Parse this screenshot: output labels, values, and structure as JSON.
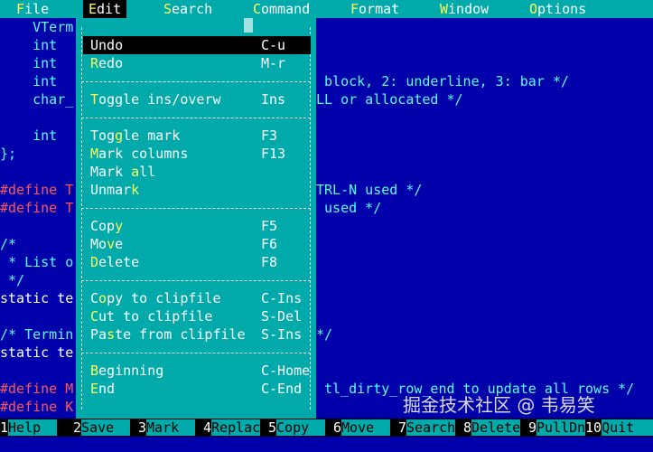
{
  "menubar": {
    "file": {
      "hk": "F",
      "rest": "ile"
    },
    "edit": {
      "hk": "E",
      "rest": "dit"
    },
    "search": {
      "hk": "S",
      "rest": "earch"
    },
    "command": {
      "hk": "C",
      "rest": "ommand"
    },
    "format": {
      "hk": "F",
      "rest": "ormat"
    },
    "window": {
      "hk": "W",
      "rest": "indow"
    },
    "options": {
      "hk": "O",
      "rest": "ptions"
    }
  },
  "editor": {
    "lines": [
      "    VTerm",
      "    int",
      "    int",
      "    int",
      "    char_",
      "",
      "    int",
      "};",
      "",
      "#define T",
      "#define T",
      "",
      "/*",
      " * List o",
      " */",
      "static te",
      "",
      "/* Termin",
      "static te",
      "",
      "#define M",
      "#define K"
    ],
    "right_fragments": {
      "r4": " block, 2: underline, 3: bar */",
      "r5": "LL or allocated */",
      "r10": "TRL-N used */",
      "r11": " used */",
      "r18": "*/",
      "r21": " tl_dirty_row_end to update all rows */"
    }
  },
  "edit_menu": {
    "undo": {
      "hk": "U",
      "rest": "ndo",
      "key": "C-u"
    },
    "redo": {
      "hk": "R",
      "rest": "edo",
      "key": "M-r"
    },
    "toggle_ins": {
      "hk": "T",
      "rest": "oggle ins/overw",
      "key": "Ins"
    },
    "toggle_mark": {
      "pre": "Tog",
      "hk": "g",
      "rest": "le mark",
      "key": "F3"
    },
    "mark_columns": {
      "hk": "M",
      "rest": "ark columns",
      "key": "F13"
    },
    "mark_all": {
      "pre": "Mark ",
      "hk": "a",
      "rest": "ll",
      "key": ""
    },
    "unmark": {
      "pre": "Unmar",
      "hk": "k",
      "rest": "",
      "key": ""
    },
    "copy": {
      "pre": "Cop",
      "hk": "y",
      "rest": "",
      "key": "F5"
    },
    "move": {
      "pre": "Mo",
      "hk": "v",
      "rest": "e",
      "key": "F6"
    },
    "delete": {
      "hk": "D",
      "rest": "elete",
      "key": "F8"
    },
    "copy_clip": {
      "pre": "C",
      "hk": "o",
      "rest": "py to clipfile",
      "key": "C-Ins"
    },
    "cut_clip": {
      "pre": "",
      "hk": "C",
      "rest": "ut to clipfile",
      "key": "S-Del"
    },
    "paste_clip": {
      "pre": "Pa",
      "hk": "s",
      "rest": "te from clipfile",
      "key": "S-Ins"
    },
    "beginning": {
      "hk": "B",
      "rest": "eginning",
      "key": "C-Home"
    },
    "end": {
      "hk": "E",
      "rest": "nd",
      "key": "C-End"
    }
  },
  "fkeys": [
    {
      "n": "1",
      "t": "Help"
    },
    {
      "n": "2",
      "t": "Save"
    },
    {
      "n": "3",
      "t": "Mark"
    },
    {
      "n": "4",
      "t": "Replac"
    },
    {
      "n": "5",
      "t": "Copy"
    },
    {
      "n": "6",
      "t": "Move"
    },
    {
      "n": "7",
      "t": "Search"
    },
    {
      "n": "8",
      "t": "Delete"
    },
    {
      "n": "9",
      "t": "PullDn"
    },
    {
      "n": "10",
      "t": "Quit"
    }
  ],
  "watermark": "掘金技术社区 @ 韦易笑",
  "colors": {
    "background": "#0000aa",
    "menu": "#00aaaa",
    "text": "#55ffff",
    "hotkey": "#ffff55",
    "preproc": "#ff5555"
  }
}
